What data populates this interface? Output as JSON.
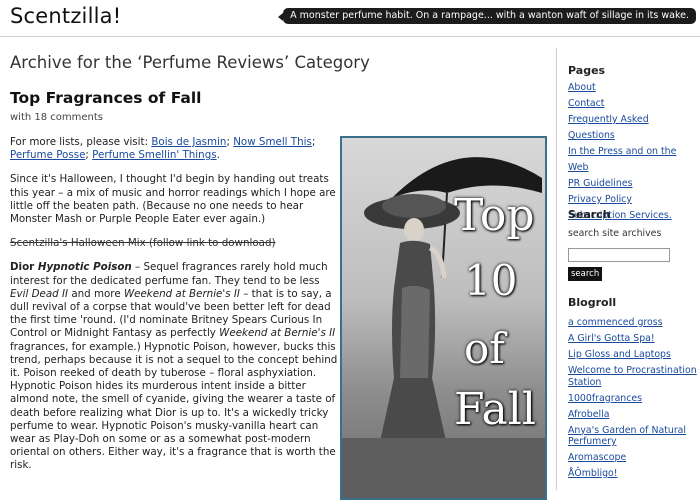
{
  "header": {
    "site_title": "Scentzilla!",
    "tagline": "A monster perfume habit. On a rampage... with a wanton waft of sillage in its wake."
  },
  "archive_title": "Archive for the ‘Perfume Reviews’ Category",
  "post": {
    "title": "Top Fragrances of Fall",
    "comments": "with 18 comments",
    "more_lists_prefix": "For more lists, please visit: ",
    "links": [
      "Bois de Jasmin",
      "Now Smell This",
      "Perfume Posse",
      "Perfume Smellin' Things"
    ],
    "paragraph_halloween": "Since it's Halloween, I thought I'd begin by handing out treats this year – a mix of music and horror readings which I hope are little off the beaten path. (Because no one needs to hear Monster Mash or Purple People Eater ever again.)",
    "halloween_mix": "Scentzilla's Halloween Mix (follow link to download)",
    "dior_brand": "Dior ",
    "dior_name": "Hypnotic Poison",
    "dior_t1": " – Sequel fragrances rarely hold much interest for the dedicated perfume fan. They tend to be less ",
    "dior_i1": "Evil Dead II",
    "dior_t2": " and more ",
    "dior_i2": "Weekend at Bernie's II",
    "dior_t3": " – that is to say, a dull revival of a corpse that would've been better left for dead the first time 'round. (I'd nominate Britney Spears Curious In Control or Midnight Fantasy as perfectly ",
    "dior_i3": "Weekend at Bernie's II",
    "dior_t4": " fragrances, for example.) Hypnotic Poison, however, bucks this trend, perhaps because it is not a sequel to the concept behind it. Poison reeked of death by tuberose – floral asphyxiation. Hypnotic Poison hides its murderous intent inside a bitter almond note, the smell of cyanide, giving the wearer a taste of death before realizing what Dior is up to. It's a wickedly tricky perfume to wear. Hypnotic Poison's musky-vanilla heart can wear as Play-Doh on some or as a somewhat post-modern oriental on others. Either way, it's a fragrance that is worth the risk."
  },
  "poster": {
    "words": [
      "Top",
      "10",
      "of",
      "Fall"
    ]
  },
  "sidebar": {
    "pages_heading": "Pages",
    "pages": [
      "About",
      "Contact",
      "Frequently Asked Questions",
      "In the Press and on the Web",
      "PR Guidelines",
      "Privacy Policy",
      "Subscription Services."
    ],
    "search_heading": "Search",
    "search_label": "search site archives",
    "search_button": "search",
    "blogroll_heading": "Blogroll",
    "blogroll": [
      "a commenced gross",
      "A Girl's Gotta Spa!",
      "Lip Gloss and Laptops",
      "Welcome to Procrastination Station",
      "1000fragrances",
      "Afrobella",
      "Anya's Garden of Natural Perfumery",
      "Aromascope",
      "ÅÔmbligo!"
    ]
  }
}
